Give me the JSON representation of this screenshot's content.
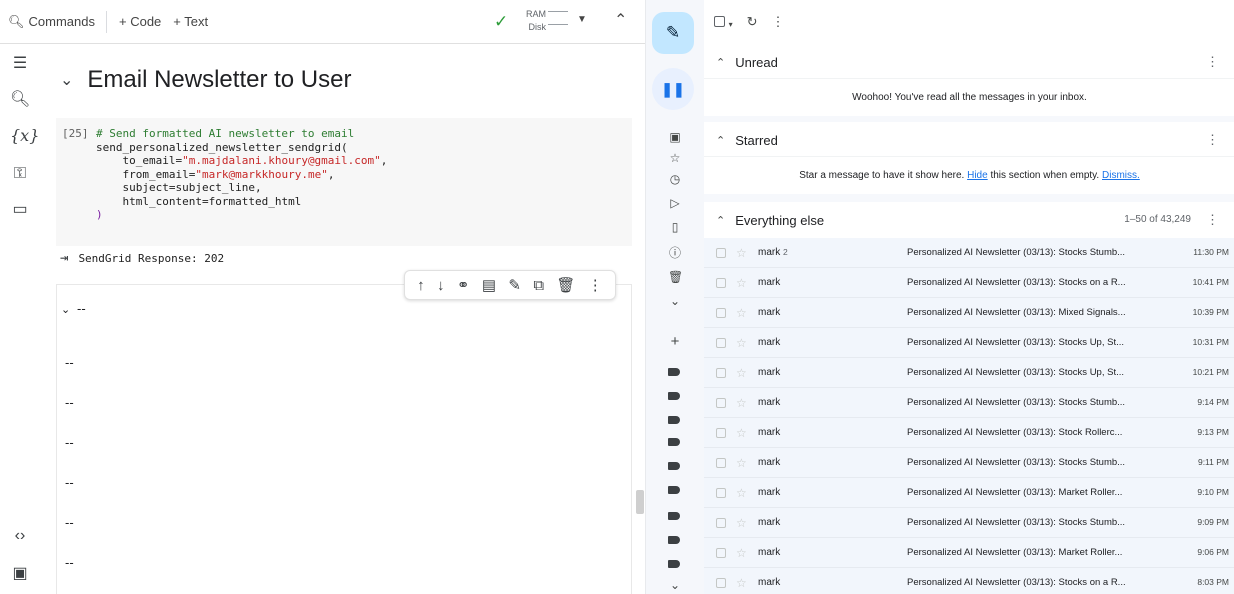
{
  "colab": {
    "toolbar": {
      "search_label": "Commands",
      "add_code_label": "+ Code",
      "add_text_label": "+ Text",
      "ram_label": "RAM",
      "disk_label": "Disk"
    },
    "section_title": "Email Newsletter to User",
    "cell": {
      "exec_count": "[25]",
      "comment": "# Send formatted AI newsletter to email",
      "call": "send_personalized_newsletter_sendgrid(",
      "to_key": "to_email=",
      "to_val": "\"m.majdalani.khoury@gmail.com\"",
      "from_key": "from_email=",
      "from_val": "\"mark@markkhoury.me\"",
      "subject_line": "subject=subject_line,",
      "html_line": "html_content=formatted_html",
      "close_paren": ")"
    },
    "output": "SendGrid Response: 202",
    "markdown": {
      "heading": "--",
      "lines": [
        "--",
        "--",
        "--",
        "--",
        "--",
        "--"
      ]
    }
  },
  "gmail": {
    "sections": {
      "unread": {
        "title": "Unread",
        "message": "Woohoo! You've read all the messages in your inbox."
      },
      "starred": {
        "title": "Starred",
        "message_pre": "Star a message to have it show here.",
        "hide_link": "Hide",
        "message_mid": "this section when empty.",
        "dismiss_link": "Dismiss."
      },
      "everything": {
        "title": "Everything else",
        "count": "1–50 of 43,249"
      }
    },
    "emails": [
      {
        "sender": "mark",
        "thread_count": "2",
        "subject": "Personalized AI Newsletter (03/13): Stocks Stumb...",
        "time": "11:30 PM"
      },
      {
        "sender": "mark",
        "thread_count": "",
        "subject": "Personalized AI Newsletter (03/13): Stocks on a R...",
        "time": "10:41 PM"
      },
      {
        "sender": "mark",
        "thread_count": "",
        "subject": "Personalized AI Newsletter (03/13): Mixed Signals...",
        "time": "10:39 PM"
      },
      {
        "sender": "mark",
        "thread_count": "",
        "subject": "Personalized AI Newsletter (03/13): Stocks Up, St...",
        "time": "10:31 PM"
      },
      {
        "sender": "mark",
        "thread_count": "",
        "subject": "Personalized AI Newsletter (03/13): Stocks Up, St...",
        "time": "10:21 PM"
      },
      {
        "sender": "mark",
        "thread_count": "",
        "subject": "Personalized AI Newsletter (03/13): Stocks Stumb...",
        "time": "9:14 PM"
      },
      {
        "sender": "mark",
        "thread_count": "",
        "subject": "Personalized AI Newsletter (03/13): Stock Rollerc...",
        "time": "9:13 PM"
      },
      {
        "sender": "mark",
        "thread_count": "",
        "subject": "Personalized AI Newsletter (03/13): Stocks Stumb...",
        "time": "9:11 PM"
      },
      {
        "sender": "mark",
        "thread_count": "",
        "subject": "Personalized AI Newsletter (03/13): Market Roller...",
        "time": "9:10 PM"
      },
      {
        "sender": "mark",
        "thread_count": "",
        "subject": "Personalized AI Newsletter (03/13): Stocks Stumb...",
        "time": "9:09 PM"
      },
      {
        "sender": "mark",
        "thread_count": "",
        "subject": "Personalized AI Newsletter (03/13): Market Roller...",
        "time": "9:06 PM"
      },
      {
        "sender": "mark",
        "thread_count": "",
        "subject": "Personalized AI Newsletter (03/13): Stocks on a R...",
        "time": "8:03 PM"
      }
    ]
  },
  "icons": {
    "colab_rail": [
      "toc-icon",
      "find-icon",
      "variables-icon",
      "secrets-key-icon",
      "folder-icon",
      "code-snippets-icon",
      "terminal-icon"
    ],
    "gmail_rail": [
      "inbox-icon",
      "star-icon",
      "clock-icon",
      "send-icon",
      "draft-icon",
      "important-icon",
      "trash-icon",
      "more-icon"
    ]
  },
  "colors": {
    "accent_green": "#2e9d3a",
    "gmail_compose": "#c2e7ff",
    "link_blue": "#1a73e8"
  }
}
